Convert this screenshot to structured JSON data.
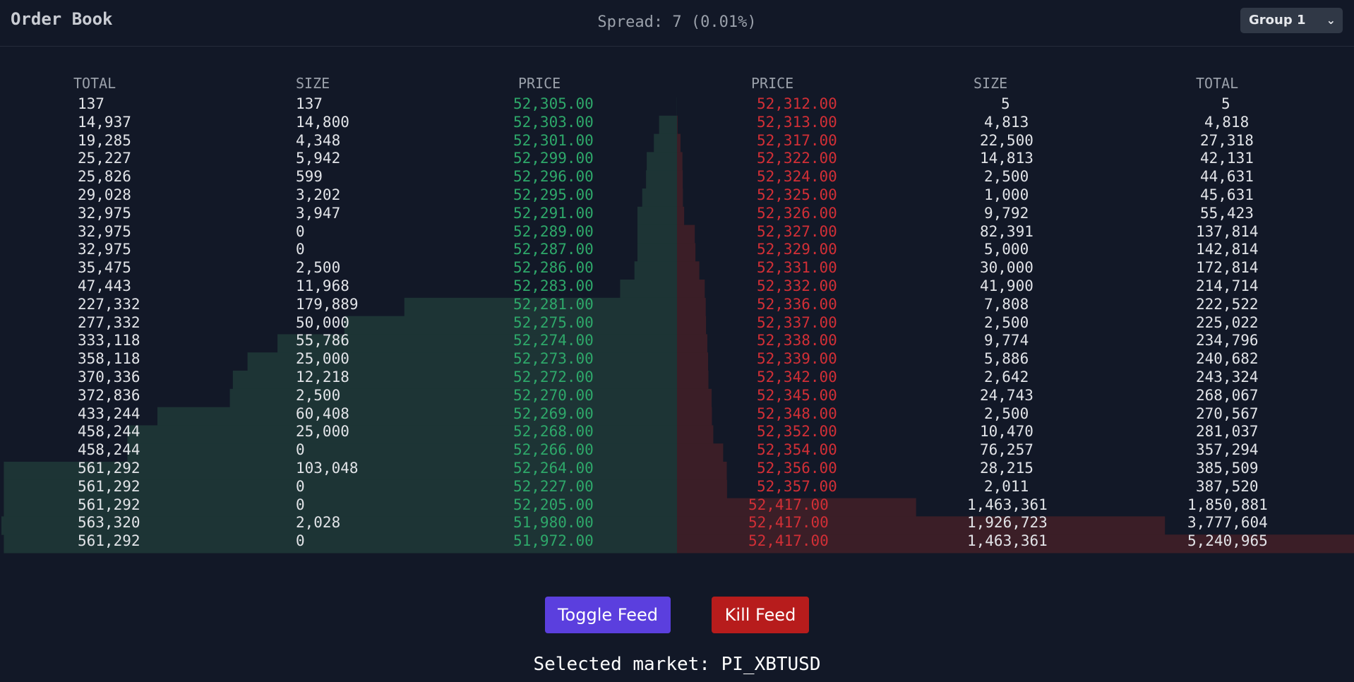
{
  "header": {
    "title": "Order Book",
    "spread_text": "Spread: 7 (0.01%)",
    "group_value": "Group 1",
    "group_icon": "chevron-down-icon"
  },
  "columns": {
    "bids": [
      "TOTAL",
      "SIZE",
      "PRICE"
    ],
    "asks": [
      "PRICE",
      "SIZE",
      "TOTAL"
    ]
  },
  "colors": {
    "bid_text": "#2ea86a",
    "ask_text": "#d22f36",
    "bid_depth": "#1d3435",
    "ask_depth": "#3b1e27",
    "toggle_button": "#5b3fde",
    "kill_button": "#b71c1c"
  },
  "bids": [
    {
      "total": "137",
      "size": "137",
      "price": "52,305.00",
      "depth": 137
    },
    {
      "total": "14,937",
      "size": "14,800",
      "price": "52,303.00",
      "depth": 14937
    },
    {
      "total": "19,285",
      "size": "4,348",
      "price": "52,301.00",
      "depth": 19285
    },
    {
      "total": "25,227",
      "size": "5,942",
      "price": "52,299.00",
      "depth": 25227
    },
    {
      "total": "25,826",
      "size": "599",
      "price": "52,296.00",
      "depth": 25826
    },
    {
      "total": "29,028",
      "size": "3,202",
      "price": "52,295.00",
      "depth": 29028
    },
    {
      "total": "32,975",
      "size": "3,947",
      "price": "52,291.00",
      "depth": 32975
    },
    {
      "total": "32,975",
      "size": "0",
      "price": "52,289.00",
      "depth": 32975
    },
    {
      "total": "32,975",
      "size": "0",
      "price": "52,287.00",
      "depth": 32975
    },
    {
      "total": "35,475",
      "size": "2,500",
      "price": "52,286.00",
      "depth": 35475
    },
    {
      "total": "47,443",
      "size": "11,968",
      "price": "52,283.00",
      "depth": 47443
    },
    {
      "total": "227,332",
      "size": "179,889",
      "price": "52,281.00",
      "depth": 227332
    },
    {
      "total": "277,332",
      "size": "50,000",
      "price": "52,275.00",
      "depth": 277332
    },
    {
      "total": "333,118",
      "size": "55,786",
      "price": "52,274.00",
      "depth": 333118
    },
    {
      "total": "358,118",
      "size": "25,000",
      "price": "52,273.00",
      "depth": 358118
    },
    {
      "total": "370,336",
      "size": "12,218",
      "price": "52,272.00",
      "depth": 370336
    },
    {
      "total": "372,836",
      "size": "2,500",
      "price": "52,270.00",
      "depth": 372836
    },
    {
      "total": "433,244",
      "size": "60,408",
      "price": "52,269.00",
      "depth": 433244
    },
    {
      "total": "458,244",
      "size": "25,000",
      "price": "52,268.00",
      "depth": 458244
    },
    {
      "total": "458,244",
      "size": "0",
      "price": "52,266.00",
      "depth": 458244
    },
    {
      "total": "561,292",
      "size": "103,048",
      "price": "52,264.00",
      "depth": 561292
    },
    {
      "total": "561,292",
      "size": "0",
      "price": "52,227.00",
      "depth": 561292
    },
    {
      "total": "561,292",
      "size": "0",
      "price": "52,205.00",
      "depth": 561292
    },
    {
      "total": "563,320",
      "size": "2,028",
      "price": "51,980.00",
      "depth": 563320
    },
    {
      "total": "561,292",
      "size": "0",
      "price": "51,972.00",
      "depth": 561292
    }
  ],
  "asks": [
    {
      "price": "52,312.00",
      "size": "5",
      "total": "5",
      "depth": 5
    },
    {
      "price": "52,313.00",
      "size": "4,813",
      "total": "4,818",
      "depth": 4818
    },
    {
      "price": "52,317.00",
      "size": "22,500",
      "total": "27,318",
      "depth": 27318
    },
    {
      "price": "52,322.00",
      "size": "14,813",
      "total": "42,131",
      "depth": 42131
    },
    {
      "price": "52,324.00",
      "size": "2,500",
      "total": "44,631",
      "depth": 44631
    },
    {
      "price": "52,325.00",
      "size": "1,000",
      "total": "45,631",
      "depth": 45631
    },
    {
      "price": "52,326.00",
      "size": "9,792",
      "total": "55,423",
      "depth": 55423
    },
    {
      "price": "52,327.00",
      "size": "82,391",
      "total": "137,814",
      "depth": 137814
    },
    {
      "price": "52,329.00",
      "size": "5,000",
      "total": "142,814",
      "depth": 142814
    },
    {
      "price": "52,331.00",
      "size": "30,000",
      "total": "172,814",
      "depth": 172814
    },
    {
      "price": "52,332.00",
      "size": "41,900",
      "total": "214,714",
      "depth": 214714
    },
    {
      "price": "52,336.00",
      "size": "7,808",
      "total": "222,522",
      "depth": 222522
    },
    {
      "price": "52,337.00",
      "size": "2,500",
      "total": "225,022",
      "depth": 225022
    },
    {
      "price": "52,338.00",
      "size": "9,774",
      "total": "234,796",
      "depth": 234796
    },
    {
      "price": "52,339.00",
      "size": "5,886",
      "total": "240,682",
      "depth": 240682
    },
    {
      "price": "52,342.00",
      "size": "2,642",
      "total": "243,324",
      "depth": 243324
    },
    {
      "price": "52,345.00",
      "size": "24,743",
      "total": "268,067",
      "depth": 268067
    },
    {
      "price": "52,348.00",
      "size": "2,500",
      "total": "270,567",
      "depth": 270567
    },
    {
      "price": "52,352.00",
      "size": "10,470",
      "total": "281,037",
      "depth": 281037
    },
    {
      "price": "52,354.00",
      "size": "76,257",
      "total": "357,294",
      "depth": 357294
    },
    {
      "price": "52,356.00",
      "size": "28,215",
      "total": "385,509",
      "depth": 385509
    },
    {
      "price": "52,357.00",
      "size": "2,011",
      "total": "387,520",
      "depth": 387520
    },
    {
      "price": "52,417.00",
      "size": "1,463,361",
      "total": "1,850,881",
      "depth": 1850881
    },
    {
      "price": "52,417.00",
      "size": "1,926,723",
      "total": "3,777,604",
      "depth": 3777604
    },
    {
      "price": "52,417.00",
      "size": "1,463,361",
      "total": "5,240,965",
      "depth": 5240965
    }
  ],
  "buttons": {
    "toggle_label": "Toggle Feed",
    "kill_label": "Kill Feed"
  },
  "footer": {
    "market_text": "Selected market: PI_XBTUSD"
  }
}
